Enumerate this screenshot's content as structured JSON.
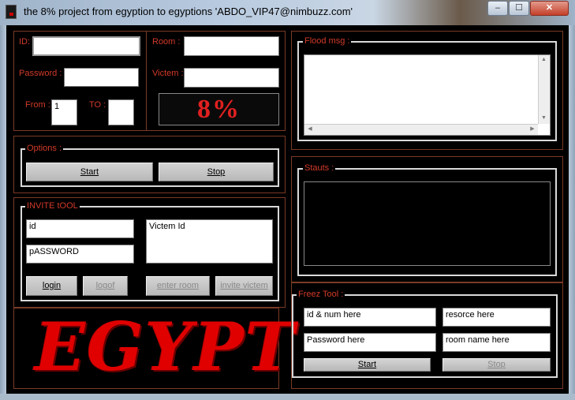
{
  "window": {
    "title": "the 8% project from egyption to egyptions 'ABDO_VIP47@nimbuzz.com'",
    "minimize_glyph": "–",
    "maximize_glyph": "☐",
    "close_glyph": "✕"
  },
  "login_panel": {
    "id_label": "ID:",
    "id_value": "",
    "password_label": "Password :",
    "password_value": "",
    "from_label": "From :",
    "from_value": "1",
    "to_label": "TO :",
    "to_value": ""
  },
  "room_panel": {
    "room_label": "Room :",
    "room_value": "",
    "victem_label": "Victem :",
    "victem_value": "",
    "logo_text": "8%"
  },
  "options": {
    "label": "Options :",
    "start_label": "Start",
    "stop_label": "Stop"
  },
  "invite_tool": {
    "label": "INVITE tOOL",
    "id_value": "id",
    "password_value": "pASSWORD",
    "victem_id_value": "Victem Id",
    "login_label": "login",
    "logof_label": "logof",
    "enter_room_label": "enter room",
    "invite_victem_label": "invite victem"
  },
  "banner": {
    "text": "EGYPT"
  },
  "flood": {
    "label": "Flood msg :",
    "value": ""
  },
  "status": {
    "label": "Stauts :",
    "value": ""
  },
  "freez_tool": {
    "label": "Freez Tool :",
    "id_num_value": "id & num here",
    "resorce_value": "resorce here",
    "password_value": "Password here",
    "room_name_value": "room name here",
    "start_label": "Start",
    "stop_label": "Stop"
  },
  "colors": {
    "accent_red": "#d23a2a",
    "panel_border": "#7a3a25",
    "background": "#000000"
  }
}
